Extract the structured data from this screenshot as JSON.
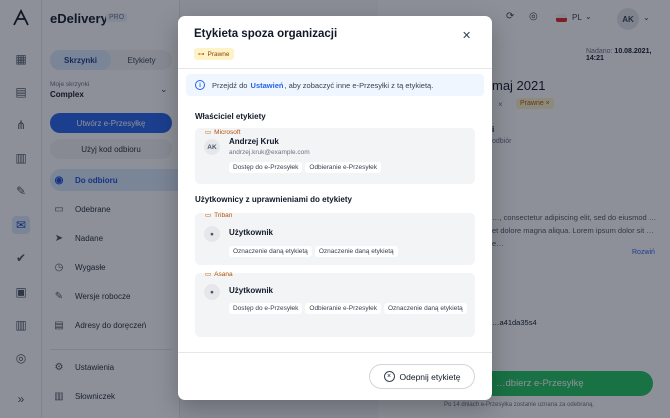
{
  "app": {
    "brand": "eDelivery",
    "plan_badge": "PRO",
    "language": "PL",
    "user_initials": "AK"
  },
  "sidebar": {
    "tabs": [
      "Skrzynki",
      "Etykiety"
    ],
    "mailbox_label": "Moje skrzynki",
    "mailbox_value": "Complex",
    "create_button": "Utwórz e-Przesyłkę",
    "code_button": "Użyj kod odbioru",
    "nav": [
      "Do odbioru",
      "Odebrane",
      "Nadane",
      "Wygasłe",
      "Wersje robocze",
      "Adresy do doręczeń"
    ],
    "bottom_nav": [
      "Ustawienia",
      "Słowniczek"
    ]
  },
  "main": {
    "sent_label": "Nadano:",
    "sent_date": "10.08.2021, 14:21",
    "title_fragment": "maj 2021",
    "tag_x": "×",
    "tag_label": "Prawne",
    "frag_line1": "i",
    "frag_line2": "odbiór",
    "body_text": "…, consectetur adipiscing elit, sed do eiusmod … et dolore magna aliqua. Lorem ipsum dolor sit … e…",
    "expand_link": "Rozwiń",
    "hash": "…a41da35s4",
    "receive_button": "…dbierz e-Przesyłkę",
    "footnote": "Po 14 dniach e-Przesyłka zostanie uznana za odebraną."
  },
  "modal": {
    "title": "Etykieta spoza organizacji",
    "tag": "Prawne",
    "info_before": "Przejdź do",
    "info_link": "Ustawień",
    "info_after": ", aby zobaczyć inne e-Przesyłki z tą etykietą.",
    "owner_section": "Właściciel etykiety",
    "owner": {
      "org": "Microsoft",
      "initials": "AK",
      "name": "Andrzej Kruk",
      "email": "andrzej.kruk@example.com",
      "permissions": [
        "Dostęp do e-Przesyłek",
        "Odbieranie e-Przesyłek"
      ]
    },
    "users_section": "Użytkownicy z uprawnieniami do etykiety",
    "users": [
      {
        "org": "Triban",
        "name": "Użytkownik",
        "permissions": [
          "Oznaczenie daną etykietą",
          "Oznaczenie daną etykietą"
        ]
      },
      {
        "org": "Asana",
        "name": "Użytkownik",
        "permissions": [
          "Dostęp do e-Przesyłek",
          "Odbieranie e-Przesyłek",
          "Oznaczenie daną etykietą"
        ]
      }
    ],
    "unpin_button": "Odepnij etykietę"
  },
  "colors": {
    "primary": "#2563eb",
    "success": "#22c55e",
    "tag_bg": "#fef3c7",
    "tag_fg": "#b45309"
  }
}
